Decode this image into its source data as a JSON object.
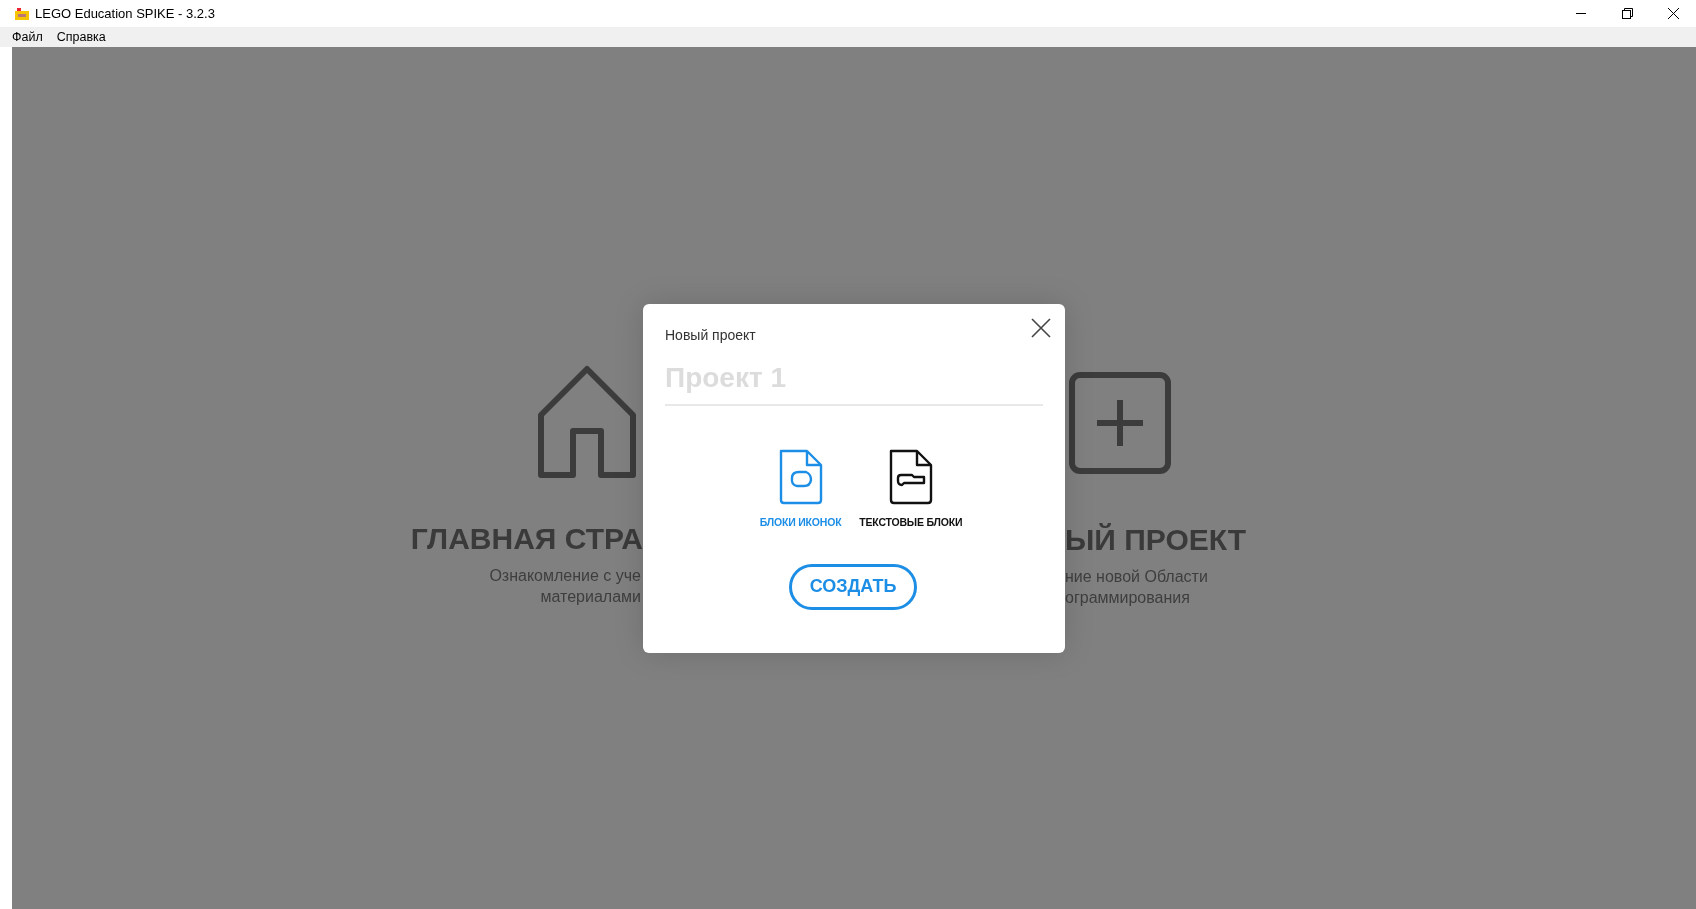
{
  "window": {
    "title": "LEGO Education SPIKE - 3.2.3"
  },
  "menu": [
    "Файл",
    "Справка"
  ],
  "background_cards": [
    {
      "kind": "home",
      "title": "ГЛАВНАЯ СТРА",
      "description": [
        "Ознакомление с уче",
        "материалами"
      ]
    },
    {
      "kind": "new",
      "title": "ЫЙ ПРОЕКТ",
      "description": [
        "ние новой Области",
        "ограммирования"
      ]
    }
  ],
  "dialog": {
    "title": "Новый проект",
    "name_field": {
      "placeholder": "Проект 1"
    },
    "options": [
      {
        "kind": "icon",
        "label": "БЛОКИ ИКОНОК",
        "selected": true
      },
      {
        "kind": "text",
        "label": "ТЕКСТОВЫЕ БЛОКИ",
        "selected": false
      }
    ],
    "create_button": "СОЗДАТЬ"
  }
}
